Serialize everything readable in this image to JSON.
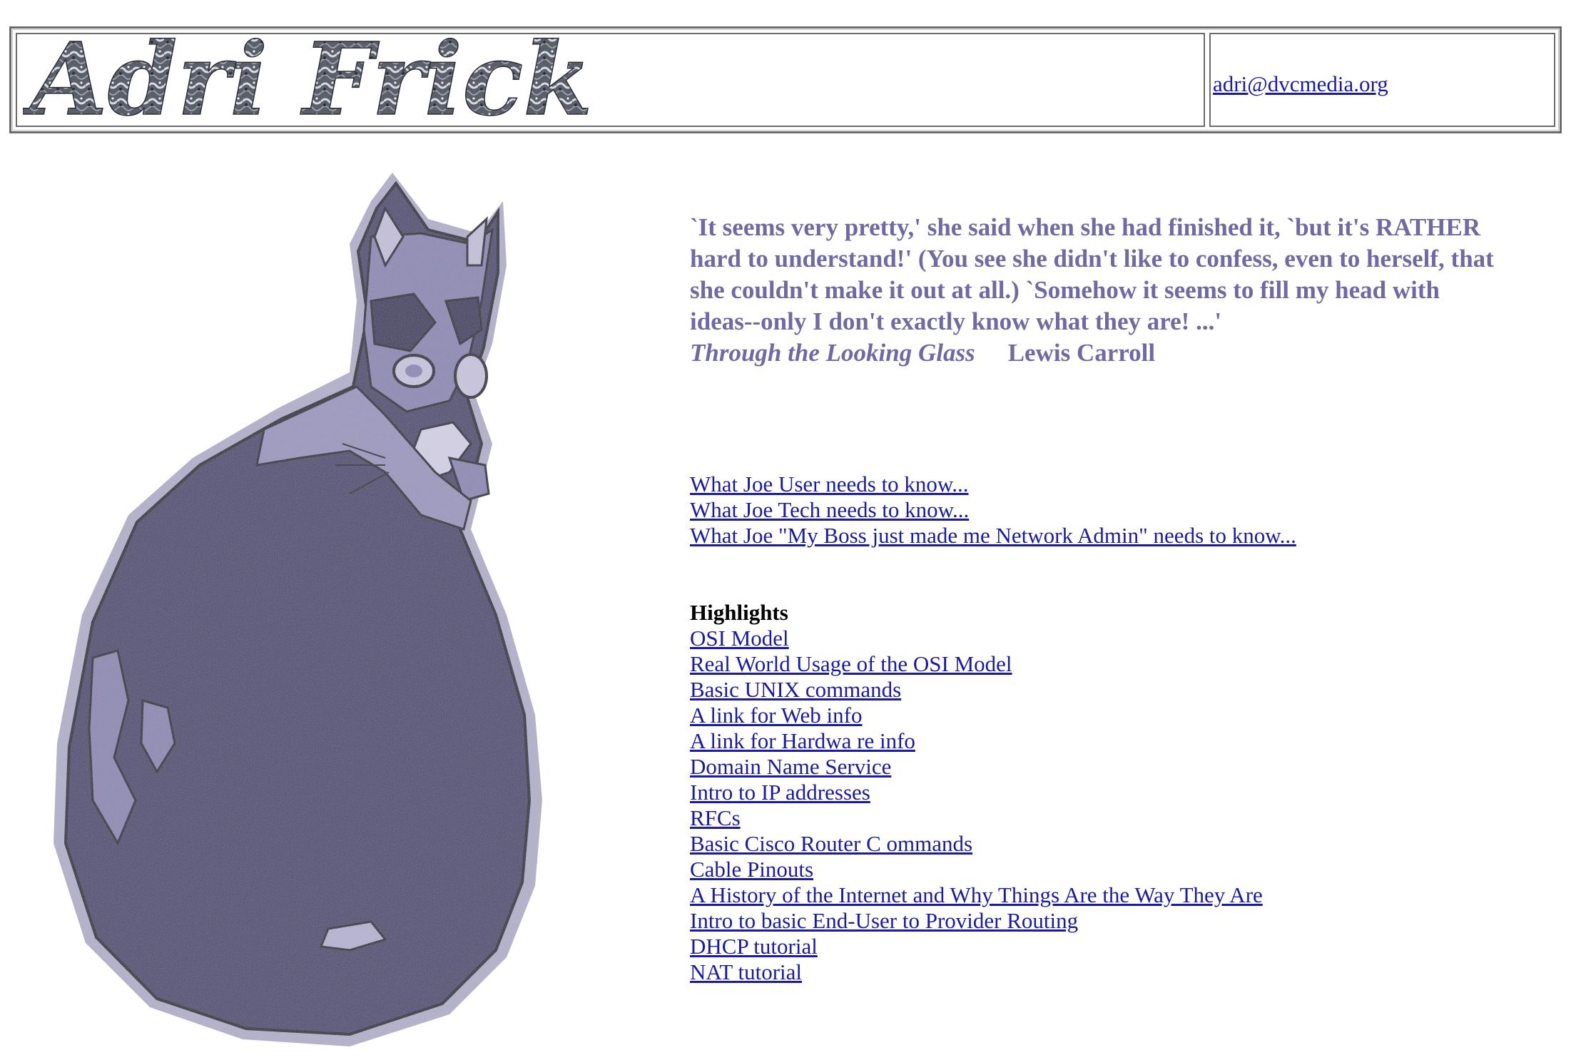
{
  "header": {
    "logo_text": "Adri Frick",
    "email": "adri@dvcmedia.org"
  },
  "quote": {
    "lines": [
      "`It seems very pretty,' she said when she had finished it, `but it's RATHER",
      "hard to understand!' (You see she didn't like to confess, even to herself, that",
      "she couldn't make it out at all.) `Somehow it seems to fill my head with",
      "ideas--only I don't exactly know what they are! ...'"
    ],
    "title": "Through the Looking Glass",
    "author": "Lewis Carroll"
  },
  "joe_links": [
    "What Joe User needs to know...",
    "What Joe Tech needs to know...",
    "What Joe \"My Boss just made me Network Admin\" needs to know..."
  ],
  "highlights": {
    "heading": "Highlights",
    "links": [
      "OSI Model",
      "Real World Usage of the OSI Model",
      "Basic UNIX commands",
      "A link for Web info",
      "A link for Hardwa re info",
      "Domain Name Service",
      "Intro to IP addresses",
      "RFCs",
      "Basic Cisco Router C ommands",
      "Cable Pinouts",
      "A History of the Internet and Why Things Are the Way They Are",
      "Intro to basic End-User to Provider Routing",
      "DHCP tutorial",
      "NAT tutorial"
    ]
  },
  "colors": {
    "link": "#1a1aa6",
    "quote": "#6f6aa3",
    "cat_body": "#4e4a72",
    "cat_light": "#a9a6c8"
  },
  "icons": {
    "cat": "cat-illustration",
    "logo": "script-logo"
  }
}
